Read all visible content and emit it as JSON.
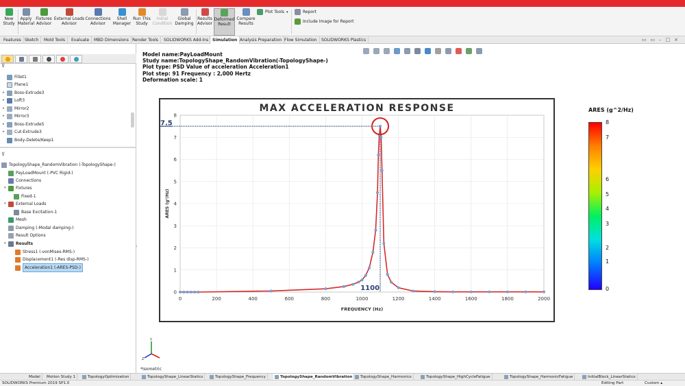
{
  "ribbon": {
    "buttons": [
      {
        "label": "New\nStudy"
      },
      {
        "label": "Apply\nMaterial"
      },
      {
        "label": "Fixtures\nAdvisor"
      },
      {
        "label": "External Loads\nAdvisor"
      },
      {
        "label": "Connections\nAdvisor"
      },
      {
        "label": "Shell\nManager"
      },
      {
        "label": "Run This\nStudy"
      },
      {
        "label": "Initial\nCondition"
      },
      {
        "label": "Global\nDamping"
      },
      {
        "label": "Results\nAdvisor"
      },
      {
        "label": "Deformed\nResult"
      },
      {
        "label": "Compare\nResults"
      }
    ],
    "plot_tools": "Plot Tools",
    "report": "Report",
    "include_image": "Include Image for Report"
  },
  "cmd_tabs": [
    "Features",
    "Sketch",
    "Mold Tools",
    "Evaluate",
    "MBD Dimensions",
    "Render Tools",
    "SOLIDWORKS Add-Ins",
    "Simulation",
    "Analysis Preparation",
    "Flow Simulation",
    "SOLIDWORKS Plastics"
  ],
  "feature_tree": [
    "Fillet1",
    "Plane1",
    "Boss-Extrude3",
    "Loft3",
    "Mirror2",
    "Mirror3",
    "Boss-Extrude5",
    "Cut-Extrude3",
    "Body-Delete/Keep1"
  ],
  "sim_tree": {
    "study": "TopologyShape_RandomVibration (-TopologyShape-)",
    "part": "PayLoadMount (-PVC Rigid-)",
    "connections": "Connections",
    "fixtures": "Fixtures",
    "fixed": "Fixed-1",
    "external_loads": "External Loads",
    "base_excitation": "Base Excitation-1",
    "mesh": "Mesh",
    "damping": "Damping (-Modal damping-)",
    "result_options": "Result Options",
    "results": "Results",
    "stress": "Stress1 (-vonMises-RMS-)",
    "displacement": "Displacement1 (-Res disp-RMS-)",
    "acceleration": "Acceleration1 (-ARES-PSD-)"
  },
  "info": {
    "model": "Model name:PayLoadMount",
    "study": "Study name:TopologyShape_RandomVibration(-TopologyShape-)",
    "plot_type": "Plot type: PSD Value of acceleration Acceleration1",
    "plot_step": "Plot step: 91 Frequency : 2,000 Hertz",
    "deformation": "Deformation scale: 1"
  },
  "chart_data": {
    "type": "line",
    "title": "MAX ACCELERATION RESPONSE",
    "xlabel": "FREQUENCY (Hz)",
    "ylabel": "ARES (g²/Hz)",
    "xlim": [
      0,
      2000
    ],
    "ylim": [
      0,
      8
    ],
    "xticks": [
      0,
      200,
      400,
      600,
      800,
      1000,
      1200,
      1400,
      1600,
      1800,
      2000
    ],
    "yticks": [
      0,
      1,
      2,
      3,
      4,
      5,
      6,
      7,
      8
    ],
    "grid": true,
    "series": [
      {
        "x": [
          0,
          20,
          40,
          60,
          80,
          100,
          500,
          800,
          900,
          950,
          980,
          1000,
          1020,
          1040,
          1060,
          1075,
          1085,
          1090,
          1095,
          1100,
          1105,
          1110,
          1120,
          1140,
          1160,
          1200,
          1280,
          1400,
          1500,
          1600,
          1700,
          1800,
          1900,
          2000
        ],
        "y": [
          0,
          0,
          0,
          0,
          0,
          0,
          0.05,
          0.15,
          0.25,
          0.35,
          0.45,
          0.55,
          0.75,
          1.1,
          1.8,
          2.8,
          4.5,
          6.2,
          7.1,
          7.5,
          7.0,
          5.5,
          2.2,
          0.8,
          0.45,
          0.2,
          0.05,
          0.02,
          0.01,
          0.01,
          0.01,
          0.01,
          0.01,
          0.01
        ]
      }
    ],
    "peak": {
      "x": 1100,
      "y": 7.5,
      "x_label": "1100",
      "y_label": "7.5"
    }
  },
  "legend": {
    "title": "ARES (g^2/Hz)",
    "ticks": [
      "8",
      "7",
      "6",
      "5",
      "4",
      "3",
      "2",
      "1",
      "0"
    ]
  },
  "view_label": "*Isometric",
  "bottom_tabs": [
    "Model",
    "Motion Study 1",
    "TopologyOptimization",
    "TopologyShape_LinearStatics",
    "TopologyShape_Frequency",
    "TopologyShape_RandomVibration",
    "TopologyShape_Harmonics",
    "TopologyShape_HighCycleFatigue",
    "TopologyShape_HarmonicFatigue",
    "InitialBlock_LinearStatics"
  ],
  "status": {
    "app": "SOLIDWORKS Premium 2019 SP1.0",
    "mode": "Editing Part",
    "units": "Custom"
  }
}
